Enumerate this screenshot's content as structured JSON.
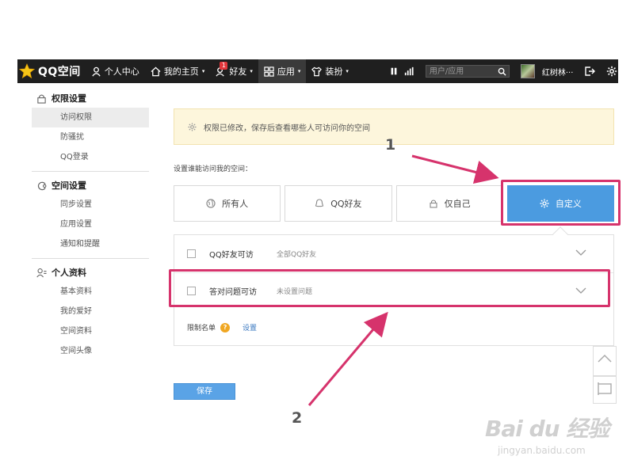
{
  "topbar": {
    "logo_text": "QQ空间",
    "nav": [
      {
        "label": "个人中心",
        "icon": "person-icon"
      },
      {
        "label": "我的主页",
        "icon": "home-icon",
        "caret": "▾"
      },
      {
        "label": "好友",
        "icon": "friends-icon",
        "caret": "▾",
        "badge": "1"
      },
      {
        "label": "应用",
        "icon": "apps-grid-icon",
        "caret": "▾"
      },
      {
        "label": "装扮",
        "icon": "shirt-icon",
        "caret": "▾"
      }
    ],
    "search_placeholder": "用户/应用",
    "username": "红树林···"
  },
  "sidebar": {
    "sections": [
      {
        "title": "权限设置",
        "icon": "lock-icon",
        "items": [
          "访问权限",
          "防骚扰",
          "QQ登录"
        ]
      },
      {
        "title": "空间设置",
        "icon": "space-settings-icon",
        "items": [
          "同步设置",
          "应用设置",
          "通知和提醒"
        ]
      },
      {
        "title": "个人资料",
        "icon": "profile-icon",
        "items": [
          "基本资料",
          "我的爱好",
          "空间资料",
          "空间头像"
        ]
      }
    ],
    "active_item": "访问权限"
  },
  "main": {
    "notice": "权限已修改，保存后查看哪些人可访问你的空间",
    "prompt": "设置谁能访问我的空间：",
    "options": [
      {
        "label": "所有人",
        "icon": "globe-icon"
      },
      {
        "label": "QQ好友",
        "icon": "qq-penguin-icon"
      },
      {
        "label": "仅自己",
        "icon": "lock-icon"
      },
      {
        "label": "自定义",
        "icon": "gear-icon",
        "selected": true
      }
    ],
    "rows": [
      {
        "label": "QQ好友可访",
        "sub": "全部QQ好友"
      },
      {
        "label": "答对问题可访",
        "sub": "未设置问题"
      }
    ],
    "limit_label": "限制名单",
    "limit_link": "设置",
    "save_label": "保存"
  },
  "annotations": {
    "step1": "1",
    "step2": "2",
    "color": "#d6336c"
  },
  "watermark": {
    "main": "Bai du 经验",
    "sub": "jingyan.baidu.com"
  }
}
